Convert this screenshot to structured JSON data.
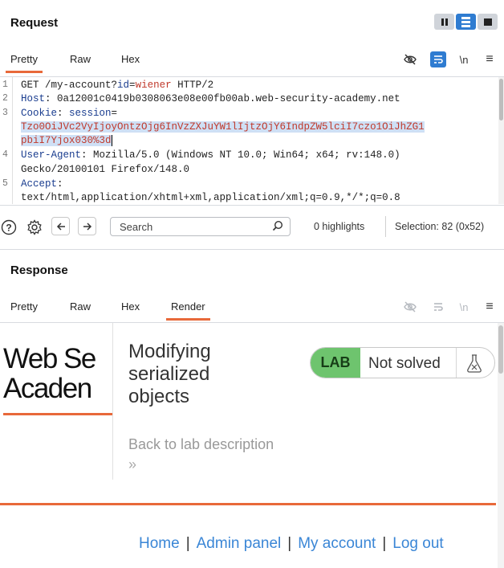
{
  "request": {
    "title": "Request",
    "tabs": [
      "Pretty",
      "Raw",
      "Hex"
    ],
    "active_tab": "Pretty",
    "tools": {
      "hide_icon": "eye-slash-icon",
      "wrap_icon": "wrap-lines-icon",
      "newline_label": "\\n",
      "menu_icon": "hamburger-menu-icon"
    },
    "lines": {
      "l1": {
        "num": "1",
        "method": "GET /my-account?",
        "param": "id",
        "eq": "=",
        "val": "wiener",
        "proto": " HTTP/2"
      },
      "l2": {
        "num": "2",
        "key": "Host",
        "val": ": 0a12001c0419b0308063e08e00fb00ab.web-security-academy.net"
      },
      "l3": {
        "num": "3",
        "key": "Cookie",
        "colon": ": ",
        "key2": "session",
        "eq": "="
      },
      "l3b": "Tzo0OiJVc2VyIjoyOntzOjg6InVzZXJuYW1lIjtzOjY6IndpZW5lciI7czo1OiJhZG1",
      "l3c": "pbiI7Yjox030%3d",
      "l4": {
        "num": "4",
        "key": "User-Agent",
        "val": ": Mozilla/5.0 (Windows NT 10.0; Win64; x64; rv:148.0)"
      },
      "l4b": "Gecko/20100101 Firefox/148.0",
      "l5": {
        "num": "5",
        "key": "Accept",
        "colon": ":"
      },
      "l5b": "text/html,application/xhtml+xml,application/xml;q=0.9,*/*;q=0.8"
    }
  },
  "search": {
    "placeholder": "Search",
    "highlights": "0 highlights",
    "selection": "Selection: 82 (0x52)"
  },
  "response": {
    "title": "Response",
    "tabs": [
      "Pretty",
      "Raw",
      "Hex",
      "Render"
    ],
    "active_tab": "Render"
  },
  "page": {
    "logo_line1": "Web Se",
    "logo_line2": "Acaden",
    "lab_title_l1": "Modifying",
    "lab_title_l2": "serialized",
    "lab_title_l3": "objects",
    "back_link": "Back to lab description",
    "back_chevron": "»",
    "badge_lab": "LAB",
    "badge_status": "Not solved",
    "nav": [
      "Home",
      "Admin panel",
      "My account",
      "Log out"
    ],
    "nav_sep": "|"
  },
  "colors": {
    "accent": "#e8693a",
    "blue": "#2f7cd1",
    "lab_green": "#6ec46e",
    "link": "#3a86d6"
  }
}
